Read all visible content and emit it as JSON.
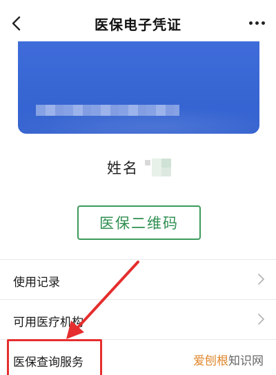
{
  "header": {
    "title": "医保电子凭证",
    "back_icon": "chevron-left-icon",
    "more_icon": "more-dots-icon"
  },
  "card": {
    "color": "#3766d3"
  },
  "profile": {
    "name_label": "姓名"
  },
  "qr_button": {
    "label": "医保二维码",
    "color": "#3a9a5b"
  },
  "menu": {
    "items": [
      {
        "label": "使用记录"
      },
      {
        "label": "可用医疗机构"
      },
      {
        "label": "医保查询服务"
      }
    ]
  },
  "watermark": {
    "part1": "爱刨根",
    "part2": "知识网"
  },
  "annotation": {
    "highlight_color": "#e52d2d"
  }
}
